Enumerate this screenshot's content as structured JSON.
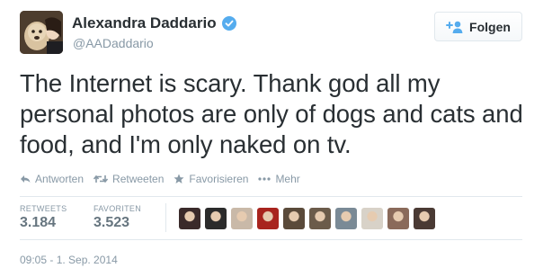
{
  "user": {
    "name": "Alexandra Daddario",
    "handle": "@AADaddario",
    "verified": true
  },
  "follow_button": {
    "label": "Folgen",
    "icon": "add-user-icon",
    "accent": "#55acee"
  },
  "tweet": {
    "text": "The Internet is scary. Thank god all my personal photos are only of dogs and cats and food, and I'm only naked on tv."
  },
  "actions": [
    {
      "label": "Antworten",
      "icon": "reply-icon"
    },
    {
      "label": "Retweeten",
      "icon": "retweet-icon"
    },
    {
      "label": "Favorisieren",
      "icon": "star-icon"
    },
    {
      "label": "Mehr",
      "icon": "more-icon"
    }
  ],
  "stats": {
    "retweets_label": "RETWEETS",
    "retweets_value": "3.184",
    "favorites_label": "FAVORITEN",
    "favorites_value": "3.523"
  },
  "favorited_by": [
    {
      "color": "#3a2a2a"
    },
    {
      "color": "#2b2b2b"
    },
    {
      "color": "#c9b9a8"
    },
    {
      "color": "#a8241e"
    },
    {
      "color": "#5a4a3a"
    },
    {
      "color": "#6b5b4a"
    },
    {
      "color": "#7a8a96"
    },
    {
      "color": "#d8d2c8"
    },
    {
      "color": "#8a6a5a"
    },
    {
      "color": "#4a3a34"
    }
  ],
  "timestamp": "09:05 - 1. Sep. 2014",
  "colors": {
    "text": "#292f33",
    "muted": "#8899a6",
    "verified": "#55acee",
    "border": "#e1e8ed"
  }
}
